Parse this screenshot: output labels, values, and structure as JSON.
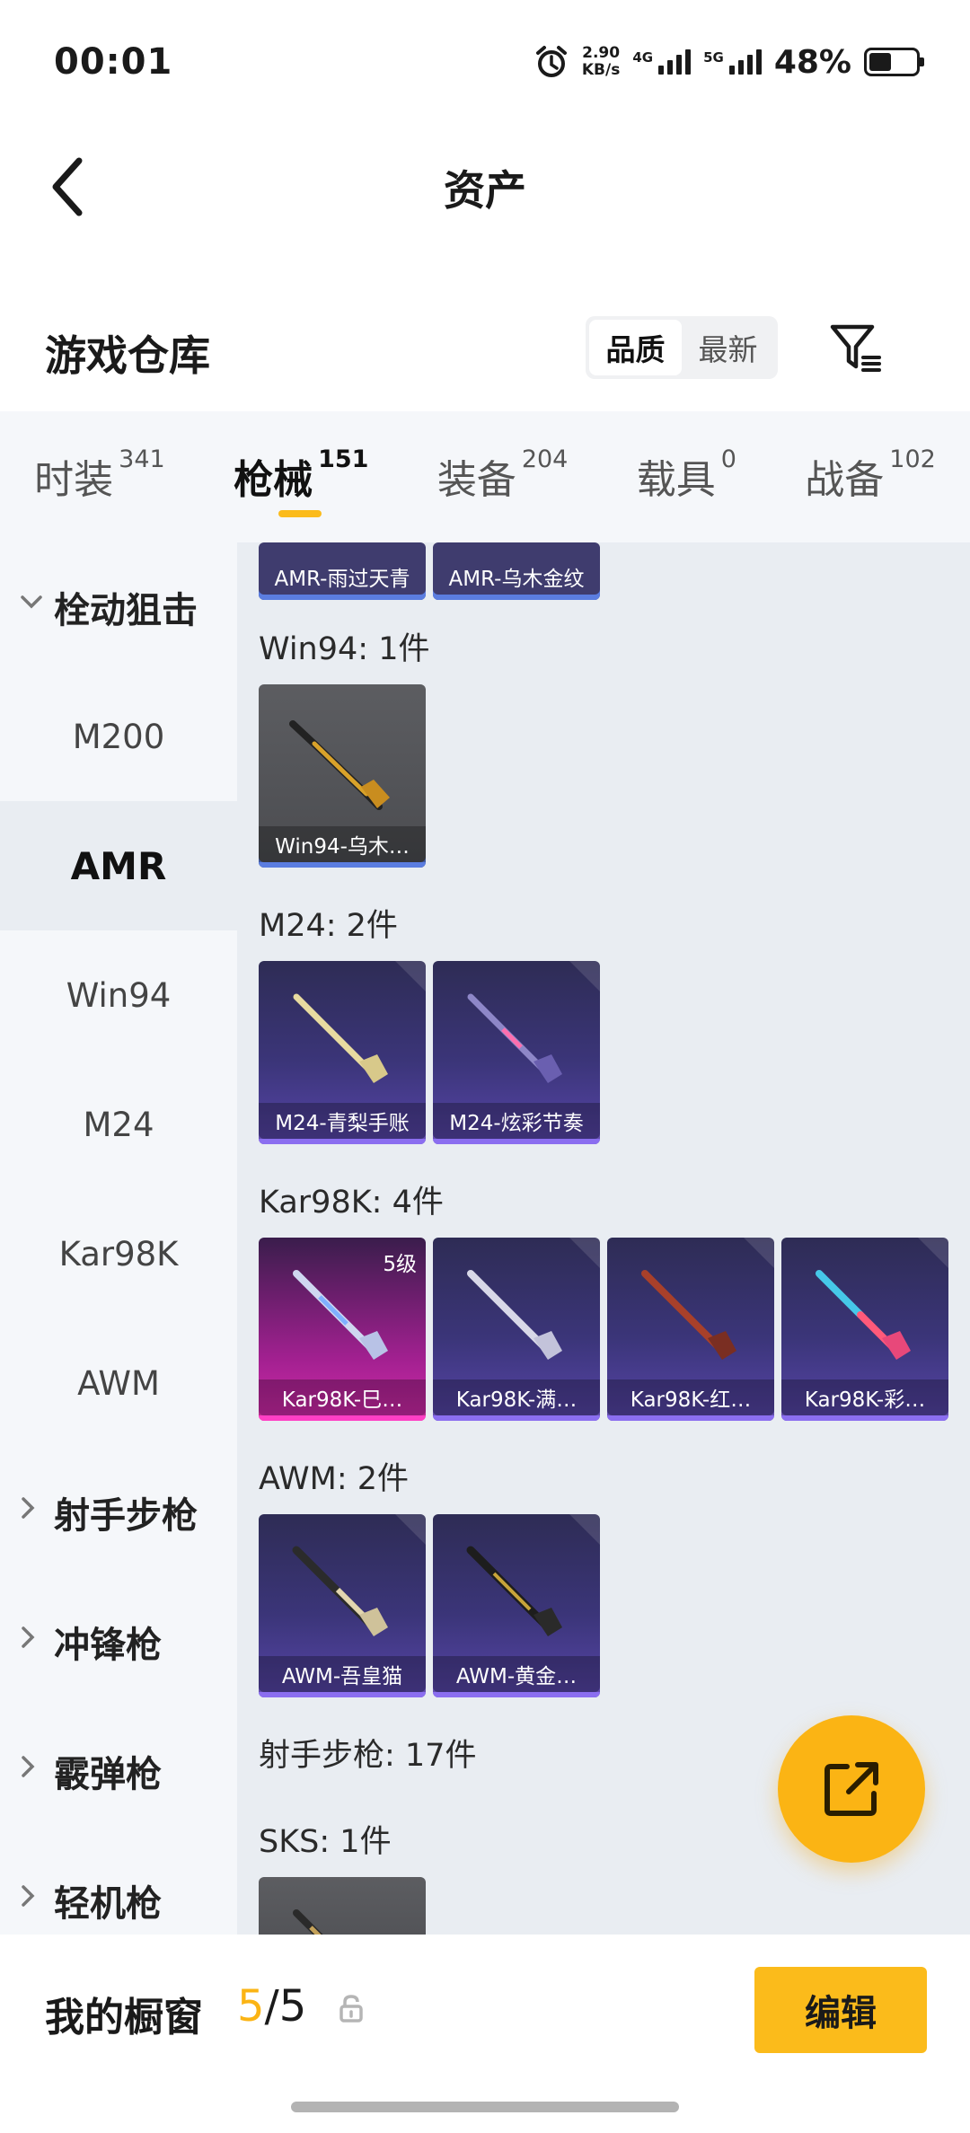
{
  "status_bar": {
    "time": "00:01",
    "net_speed_value": "2.90",
    "net_speed_unit": "KB/s",
    "signal_1_label": "4G",
    "signal_2_label": "5G",
    "battery": "48%",
    "battery_level": 0.48
  },
  "nav": {
    "title": "资产"
  },
  "warehouse": {
    "title": "游戏仓库",
    "sort_options": [
      "品质",
      "最新"
    ],
    "sort_selected": "品质"
  },
  "tabs": [
    {
      "label": "时装",
      "count": "341"
    },
    {
      "label": "枪械",
      "count": "151",
      "active": true
    },
    {
      "label": "装备",
      "count": "204"
    },
    {
      "label": "载具",
      "count": "0"
    },
    {
      "label": "战备",
      "count": "102"
    }
  ],
  "sidebar": {
    "category_bolt": "栓动狙击",
    "subs": [
      "M200",
      "AMR",
      "Win94",
      "M24",
      "Kar98K",
      "AWM"
    ],
    "active_sub": "AMR",
    "category_marksman": "射手步枪",
    "category_smg": "冲锋枪",
    "category_shotgun": "霰弹枪",
    "category_lmg": "轻机枪"
  },
  "content": {
    "amr_items": [
      "AMR-雨过天青",
      "AMR-乌木金纹"
    ],
    "win94_title": "Win94: 1件",
    "win94_items": [
      "Win94-乌木…"
    ],
    "m24_title": "M24: 2件",
    "m24_items": [
      "M24-青梨手账",
      "M24-炫彩节奏"
    ],
    "kar98k_title": "Kar98K: 4件",
    "kar98k_items": [
      "Kar98K-巳…",
      "Kar98K-满…",
      "Kar98K-红…",
      "Kar98K-彩…"
    ],
    "kar98k_level": "5级",
    "awm_title": "AWM: 2件",
    "awm_items": [
      "AWM-吾皇猫",
      "AWM-黄金…"
    ],
    "marksman_title": "射手步枪: 17件",
    "sks_title": "SKS: 1件"
  },
  "bottom_bar": {
    "title": "我的橱窗",
    "count_current": "5",
    "count_sep_total": "/5",
    "edit_label": "编辑"
  },
  "colors": {
    "accent": "#fbb414",
    "tab_underline": "#fbbb1b"
  },
  "icons": [
    "alarm-icon",
    "back-arrow-icon",
    "filter-icon",
    "chevron-down-icon",
    "chevron-right-icon",
    "share-external-icon",
    "lock-icon"
  ]
}
